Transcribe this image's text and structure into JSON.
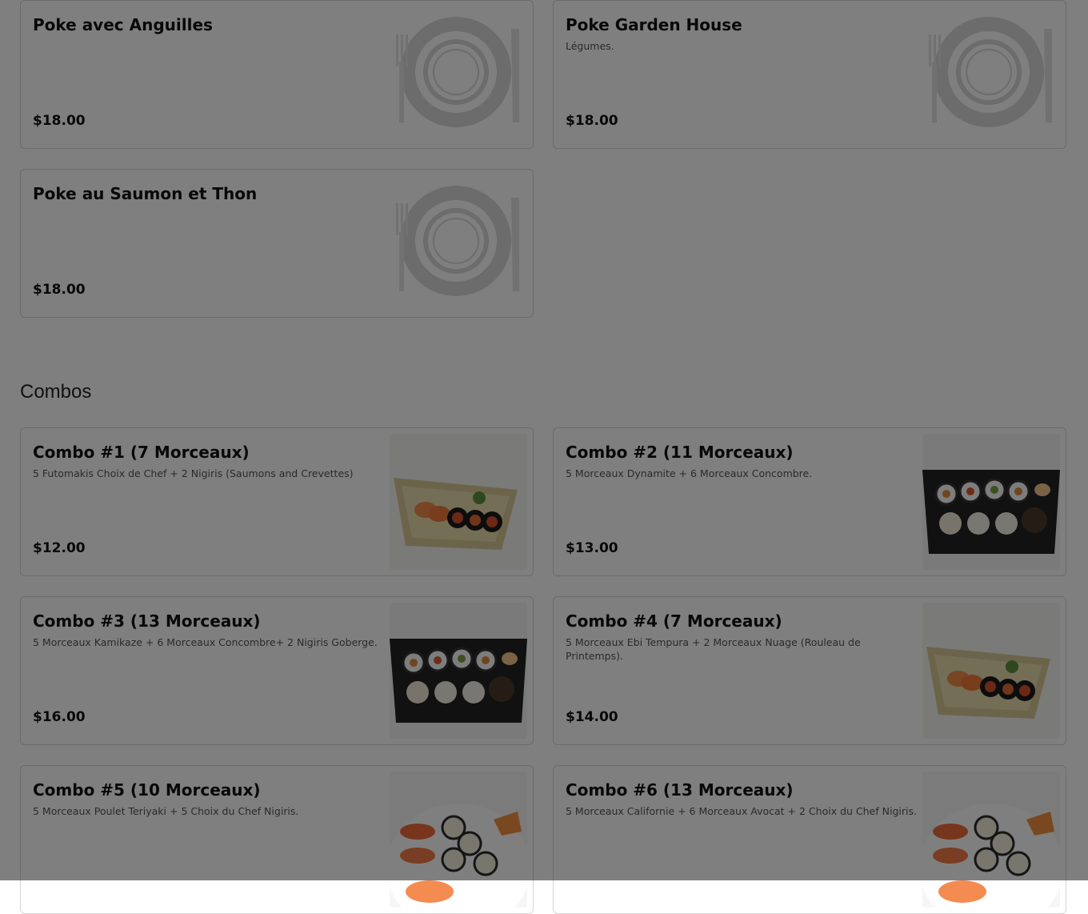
{
  "top_items": [
    {
      "title": "Poke avec Anguilles",
      "description": "",
      "price": "$18.00",
      "image": "plate-placeholder-icon"
    },
    {
      "title": "Poke Garden House",
      "description": "Légumes.",
      "price": "$18.00",
      "image": "plate-placeholder-icon"
    },
    {
      "title": "Poke au Saumon et Thon",
      "description": "",
      "price": "$18.00",
      "image": "plate-placeholder-icon"
    }
  ],
  "combos": {
    "heading": "Combos",
    "items": [
      {
        "title": "Combo #1 (7 Morceaux)",
        "description": "5 Futomakis Choix de Chef + 2 Nigiris (Saumons and Crevettes)",
        "price": "$12.00",
        "image": "sushi-boat-photo"
      },
      {
        "title": "Combo #2 (11 Morceaux)",
        "description": "5 Morceaux Dynamite + 6 Morceaux Concombre.",
        "price": "$13.00",
        "image": "sushi-tray-photo"
      },
      {
        "title": "Combo #3 (13 Morceaux)",
        "description": "5 Morceaux Kamikaze + 6 Morceaux Concombre+ 2 Nigiris Goberge.",
        "price": "$16.00",
        "image": "sushi-tray-photo"
      },
      {
        "title": "Combo #4 (7 Morceaux)",
        "description": "5 Morceaux Ebi Tempura + 2 Morceaux Nuage (Rouleau de Printemps).",
        "price": "$14.00",
        "image": "sushi-boat-photo"
      },
      {
        "title": "Combo #5 (10 Morceaux)",
        "description": "5 Morceaux Poulet Teriyaki + 5 Choix du Chef Nigiris.",
        "price": "",
        "image": "sushi-plate-photo"
      },
      {
        "title": "Combo #6 (13 Morceaux)",
        "description": "5 Morceaux Californie + 6 Morceaux Avocat + 2 Choix du Chef Nigiris.",
        "price": "",
        "image": "sushi-plate-photo"
      }
    ]
  },
  "colors": {
    "overlay": "#000000",
    "card_border": "#d6d6d6",
    "text": "#111111"
  }
}
